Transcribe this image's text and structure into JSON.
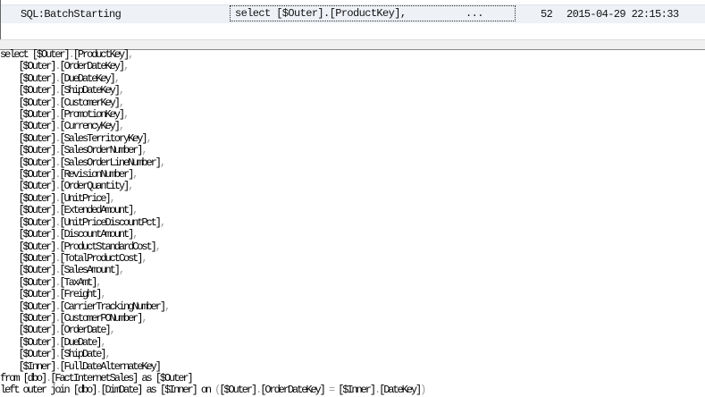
{
  "trace_row": {
    "event_class": "SQL:BatchStarting",
    "text_data": "select [$Outer].[ProductKey],",
    "ellipsis": "...",
    "spid": "52",
    "start_time": "2015-04-29 22:15:33"
  },
  "code_lines": [
    "select [$Outer].[ProductKey],",
    "    [$Outer].[OrderDateKey],",
    "    [$Outer].[DueDateKey],",
    "    [$Outer].[ShipDateKey],",
    "    [$Outer].[CustomerKey],",
    "    [$Outer].[PromotionKey],",
    "    [$Outer].[CurrencyKey],",
    "    [$Outer].[SalesTerritoryKey],",
    "    [$Outer].[SalesOrderNumber],",
    "    [$Outer].[SalesOrderLineNumber],",
    "    [$Outer].[RevisionNumber],",
    "    [$Outer].[OrderQuantity],",
    "    [$Outer].[UnitPrice],",
    "    [$Outer].[ExtendedAmount],",
    "    [$Outer].[UnitPriceDiscountPct],",
    "    [$Outer].[DiscountAmount],",
    "    [$Outer].[ProductStandardCost],",
    "    [$Outer].[TotalProductCost],",
    "    [$Outer].[SalesAmount],",
    "    [$Outer].[TaxAmt],",
    "    [$Outer].[Freight],",
    "    [$Outer].[CarrierTrackingNumber],",
    "    [$Outer].[CustomerPONumber],",
    "    [$Outer].[OrderDate],",
    "    [$Outer].[DueDate],",
    "    [$Outer].[ShipDate],",
    "    [$Inner].[FullDateAlternateKey]",
    "from [dbo].[FactInternetSales] as [$Outer]",
    "left outer join [dbo].[DimDate] as [$Inner] on ([$Outer].[OrderDateKey] = [$Inner].[DateKey])"
  ]
}
